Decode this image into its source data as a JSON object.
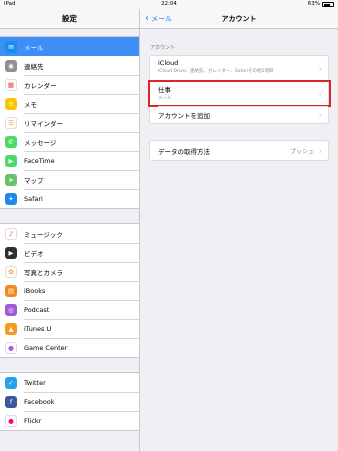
{
  "status": {
    "carrier": "iPad",
    "time": "22:04",
    "battery": "63%"
  },
  "settings": {
    "title": "設定",
    "groups": [
      [
        {
          "label": "メール",
          "icon": "mail-icon",
          "color": "#1a8cf0",
          "selected": true
        },
        {
          "label": "連絡先",
          "icon": "contacts-icon",
          "color": "#8e8e93"
        },
        {
          "label": "カレンダー",
          "icon": "calendar-icon",
          "color": "#ffffff"
        },
        {
          "label": "メモ",
          "icon": "notes-icon",
          "color": "#f7c600"
        },
        {
          "label": "リマインダー",
          "icon": "reminders-icon",
          "color": "#ffffff"
        },
        {
          "label": "メッセージ",
          "icon": "messages-icon",
          "color": "#4cd964"
        },
        {
          "label": "FaceTime",
          "icon": "facetime-icon",
          "color": "#4cd964"
        },
        {
          "label": "マップ",
          "icon": "maps-icon",
          "color": "#6cc26b"
        },
        {
          "label": "Safari",
          "icon": "safari-icon",
          "color": "#1a8cf0"
        }
      ],
      [
        {
          "label": "ミュージック",
          "icon": "music-icon",
          "color": "#ffffff"
        },
        {
          "label": "ビデオ",
          "icon": "videos-icon",
          "color": "#2e2e33"
        },
        {
          "label": "写真とカメラ",
          "icon": "photos-icon",
          "color": "#ffffff"
        },
        {
          "label": "iBooks",
          "icon": "ibooks-icon",
          "color": "#f28b1b"
        },
        {
          "label": "Podcast",
          "icon": "podcast-icon",
          "color": "#a05ad6"
        },
        {
          "label": "iTunes U",
          "icon": "itunes-u-icon",
          "color": "#f59a1c"
        },
        {
          "label": "Game Center",
          "icon": "game-center-icon",
          "color": "#ffffff"
        }
      ],
      [
        {
          "label": "Twitter",
          "icon": "twitter-icon",
          "color": "#27a2e8"
        },
        {
          "label": "Facebook",
          "icon": "facebook-icon",
          "color": "#3b5998"
        },
        {
          "label": "Flickr",
          "icon": "flickr-icon",
          "color": "#ffffff"
        }
      ]
    ]
  },
  "detail": {
    "back_label": "メール",
    "title": "アカウント",
    "section_header": "アカウント",
    "accounts": [
      {
        "title": "iCloud",
        "subtitle": "iCloud Drive、連絡先、カレンダー、Safariその他5項目"
      },
      {
        "title": "仕事",
        "subtitle": "メール"
      },
      {
        "title": "アカウントを追加",
        "subtitle": ""
      }
    ],
    "fetch": {
      "label": "データの取得方法",
      "value": "プッシュ"
    }
  },
  "colors": {
    "accent": "#157efb",
    "highlight": "#e0242a",
    "selected_row": "#3d8ef7"
  }
}
